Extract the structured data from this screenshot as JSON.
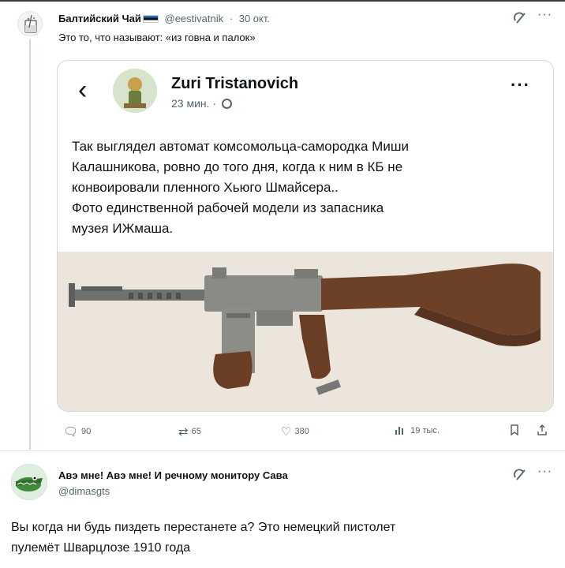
{
  "tweet": {
    "author_name": "Балтийский Чай",
    "handle": "@eestivatnik",
    "date": "30 окт.",
    "text": "Это то, что называют: «из говна и палок»"
  },
  "quoted": {
    "author_name": "Zuri Tristanovich",
    "time": "23 мин. ·",
    "lines": [
      "Так выглядел автомат комсомольца-самородка Миши",
      "Калашникова, ровно до того дня, когда к ним в КБ не",
      "конвоировали пленного Хьюго Шмайсера..",
      "Фото единственной рабочей модели из запасника",
      "музея ИЖмаша."
    ],
    "photo_icon": "weapon-photo"
  },
  "actions": {
    "reply_count": "90",
    "retweet_count": "65",
    "like_count": "380",
    "views_count": "19 тыс."
  },
  "reply": {
    "author_name": "Авэ мне! Авэ мне! И речному монитору Сава",
    "handle": "@dimasgts",
    "lines": [
      "Вы когда ни будь пиздеть перестанете а? Это немецкий пистолет",
      "пулемёт Шварцлозе 1910 года"
    ]
  },
  "icons": [
    "back-arrow-icon",
    "globe-icon",
    "more-icon",
    "grok-icon",
    "reply-icon",
    "retweet-icon",
    "like-icon",
    "views-icon",
    "bookmark-icon",
    "share-icon"
  ],
  "colors": {
    "secondary_text": "#536471",
    "border": "#cfd9de",
    "primary_text": "#0f1419"
  }
}
